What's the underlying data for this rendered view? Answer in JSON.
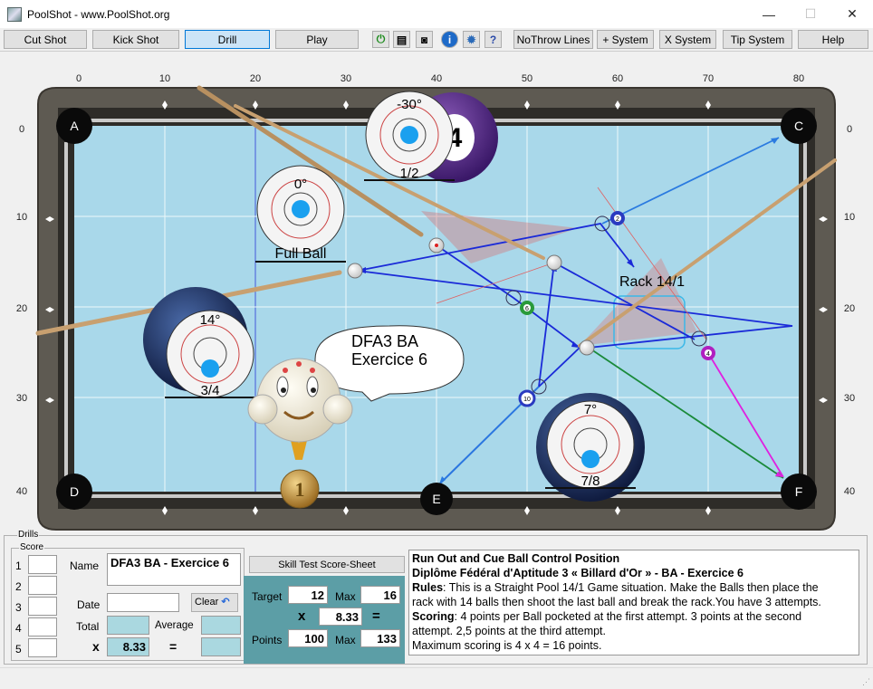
{
  "window": {
    "title": "PoolShot - www.PoolShot.org",
    "minimize": "—",
    "maximize": "☐",
    "close": "✕"
  },
  "toolbar": {
    "cut_shot": "Cut Shot",
    "kick_shot": "Kick Shot",
    "drill": "Drill",
    "play": "Play",
    "no_throw": "NoThrow Lines",
    "plus_system": "+ System",
    "x_system": "X System",
    "tip_system": "Tip System",
    "help": "Help"
  },
  "table": {
    "x_ticks": [
      "0",
      "10",
      "20",
      "30",
      "40",
      "50",
      "60",
      "70",
      "80"
    ],
    "y_ticks": [
      "0",
      "10",
      "20",
      "30",
      "40"
    ],
    "pockets": [
      "A",
      "C",
      "D",
      "E",
      "F"
    ],
    "rack_label": "Rack 14/1",
    "bubble": {
      "line1": "DFA3 BA",
      "line2": "Exercice 6"
    },
    "aims": [
      {
        "angle": "-30°",
        "fraction": "1/2"
      },
      {
        "angle": "0°",
        "fraction": "Full Ball"
      },
      {
        "angle": "14°",
        "fraction": "3/4"
      },
      {
        "angle": "7°",
        "fraction": "7/8"
      }
    ],
    "balls": [
      "2",
      "6",
      "4",
      "10"
    ],
    "big_ball": "4",
    "medal": "1"
  },
  "drills": {
    "legend": "Drills",
    "score_legend": "Score",
    "rows": [
      "1",
      "2",
      "3",
      "4",
      "5"
    ],
    "name_label": "Name",
    "name_value": "DFA3 BA - Exercice 6",
    "date_label": "Date",
    "date_value": "",
    "clear_label": "Clear",
    "total_label": "Total",
    "average_label": "Average",
    "x_label": "x",
    "x_value": "8.33",
    "eq_label": "=",
    "skill_test_label": "Skill Test Score-Sheet",
    "target_label": "Target",
    "target_value": "12",
    "max_label": "Max",
    "max_value": "16",
    "mult_value": "8.33",
    "points_label": "Points",
    "points_value": "100",
    "points_max_label": "Max",
    "points_max_value": "133",
    "rules_title": "Run Out and Cue Ball Control Position",
    "rules_subtitle": "Diplôme Fédéral d'Aptitude 3 « Billard d'Or » - BA - Exercice 6",
    "rules_label": "Rules",
    "rules_text": ": This is a Straight Pool 14/1 Game situation. Make the Balls then place the rack with 14 balls then shoot the last ball and break the rack.You have 3 attempts.",
    "scoring_label": "Scoring",
    "scoring_text": ": 4 points per Ball pocketed at the first attempt. 3 points at the second attempt. 2,5 points at the third attempt.",
    "max_text": "Maximum scoring is 4 x 4 = 16 points."
  },
  "colors": {
    "felt": "#a9d8ea",
    "rail": "#5e5a52",
    "active": "#cce4f7"
  }
}
